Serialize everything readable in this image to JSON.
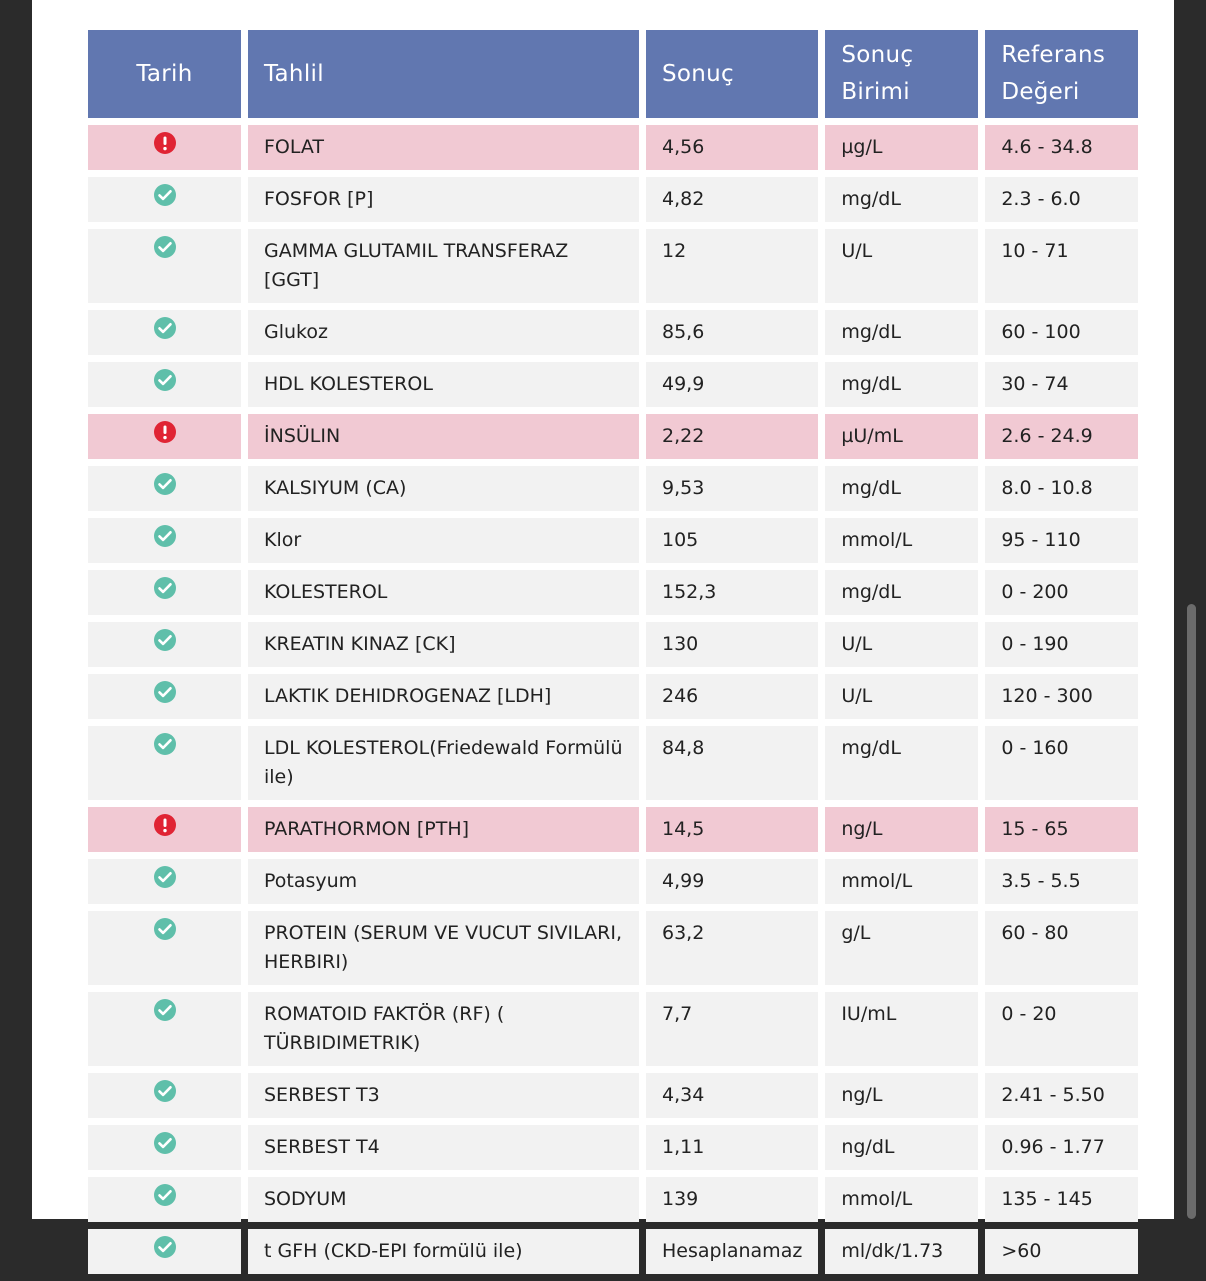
{
  "headers": {
    "date": "Tarih",
    "test": "Tahlil",
    "result": "Sonuç",
    "unit": "Sonuç Birimi",
    "reference": "Referans Değeri"
  },
  "colors": {
    "header_bg": "#6177b0",
    "abnormal_row": "#f1c9d3",
    "normal_row": "#f2f2f2",
    "ok_icon": "#5fbfaa",
    "alert_icon": "#e02434"
  },
  "rows": [
    {
      "status": "alert",
      "test": "FOLAT",
      "result": "4,56",
      "unit": "µg/L",
      "reference": "4.6 - 34.8"
    },
    {
      "status": "ok",
      "test": "FOSFOR [P]",
      "result": "4,82",
      "unit": "mg/dL",
      "reference": "2.3 - 6.0"
    },
    {
      "status": "ok",
      "test": "GAMMA GLUTAMIL TRANSFERAZ [GGT]",
      "result": "12",
      "unit": "U/L",
      "reference": "10 - 71"
    },
    {
      "status": "ok",
      "test": "Glukoz",
      "result": "85,6",
      "unit": "mg/dL",
      "reference": "60 - 100"
    },
    {
      "status": "ok",
      "test": "HDL KOLESTEROL",
      "result": "49,9",
      "unit": "mg/dL",
      "reference": "30 - 74"
    },
    {
      "status": "alert",
      "test": "İNSÜLIN",
      "result": "2,22",
      "unit": "µU/mL",
      "reference": "2.6 - 24.9"
    },
    {
      "status": "ok",
      "test": "KALSIYUM (CA)",
      "result": "9,53",
      "unit": "mg/dL",
      "reference": "8.0 - 10.8"
    },
    {
      "status": "ok",
      "test": "Klor",
      "result": "105",
      "unit": "mmol/L",
      "reference": "95 - 110"
    },
    {
      "status": "ok",
      "test": "KOLESTEROL",
      "result": "152,3",
      "unit": "mg/dL",
      "reference": "0 - 200"
    },
    {
      "status": "ok",
      "test": "KREATIN KINAZ [CK]",
      "result": "130",
      "unit": "U/L",
      "reference": "0 - 190"
    },
    {
      "status": "ok",
      "test": "LAKTIK DEHIDROGENAZ [LDH]",
      "result": "246",
      "unit": "U/L",
      "reference": "120 - 300"
    },
    {
      "status": "ok",
      "test": "LDL KOLESTEROL(Friedewald Formülü ile)",
      "result": "84,8",
      "unit": "mg/dL",
      "reference": "0 - 160"
    },
    {
      "status": "alert",
      "test": "PARATHORMON [PTH]",
      "result": "14,5",
      "unit": "ng/L",
      "reference": "15 - 65"
    },
    {
      "status": "ok",
      "test": "Potasyum",
      "result": "4,99",
      "unit": "mmol/L",
      "reference": "3.5 - 5.5"
    },
    {
      "status": "ok",
      "test": "PROTEIN (SERUM VE VUCUT SIVILARI, HERBIRI)",
      "result": "63,2",
      "unit": "g/L",
      "reference": "60 - 80"
    },
    {
      "status": "ok",
      "test": "ROMATOID FAKTÖR (RF) ( TÜRBIDIMETRIK)",
      "result": "7,7",
      "unit": "IU/mL",
      "reference": "0 - 20"
    },
    {
      "status": "ok",
      "test": "SERBEST T3",
      "result": "4,34",
      "unit": "ng/L",
      "reference": "2.41 - 5.50"
    },
    {
      "status": "ok",
      "test": "SERBEST T4",
      "result": "1,11",
      "unit": "ng/dL",
      "reference": "0.96 - 1.77"
    },
    {
      "status": "ok",
      "test": "SODYUM",
      "result": "139",
      "unit": "mmol/L",
      "reference": "135 - 145"
    },
    {
      "status": "ok",
      "test": "t GFH (CKD-EPI formülü ile)",
      "result": "Hesaplanamaz",
      "unit": "ml/dk/1.73",
      "reference": ">60"
    }
  ]
}
